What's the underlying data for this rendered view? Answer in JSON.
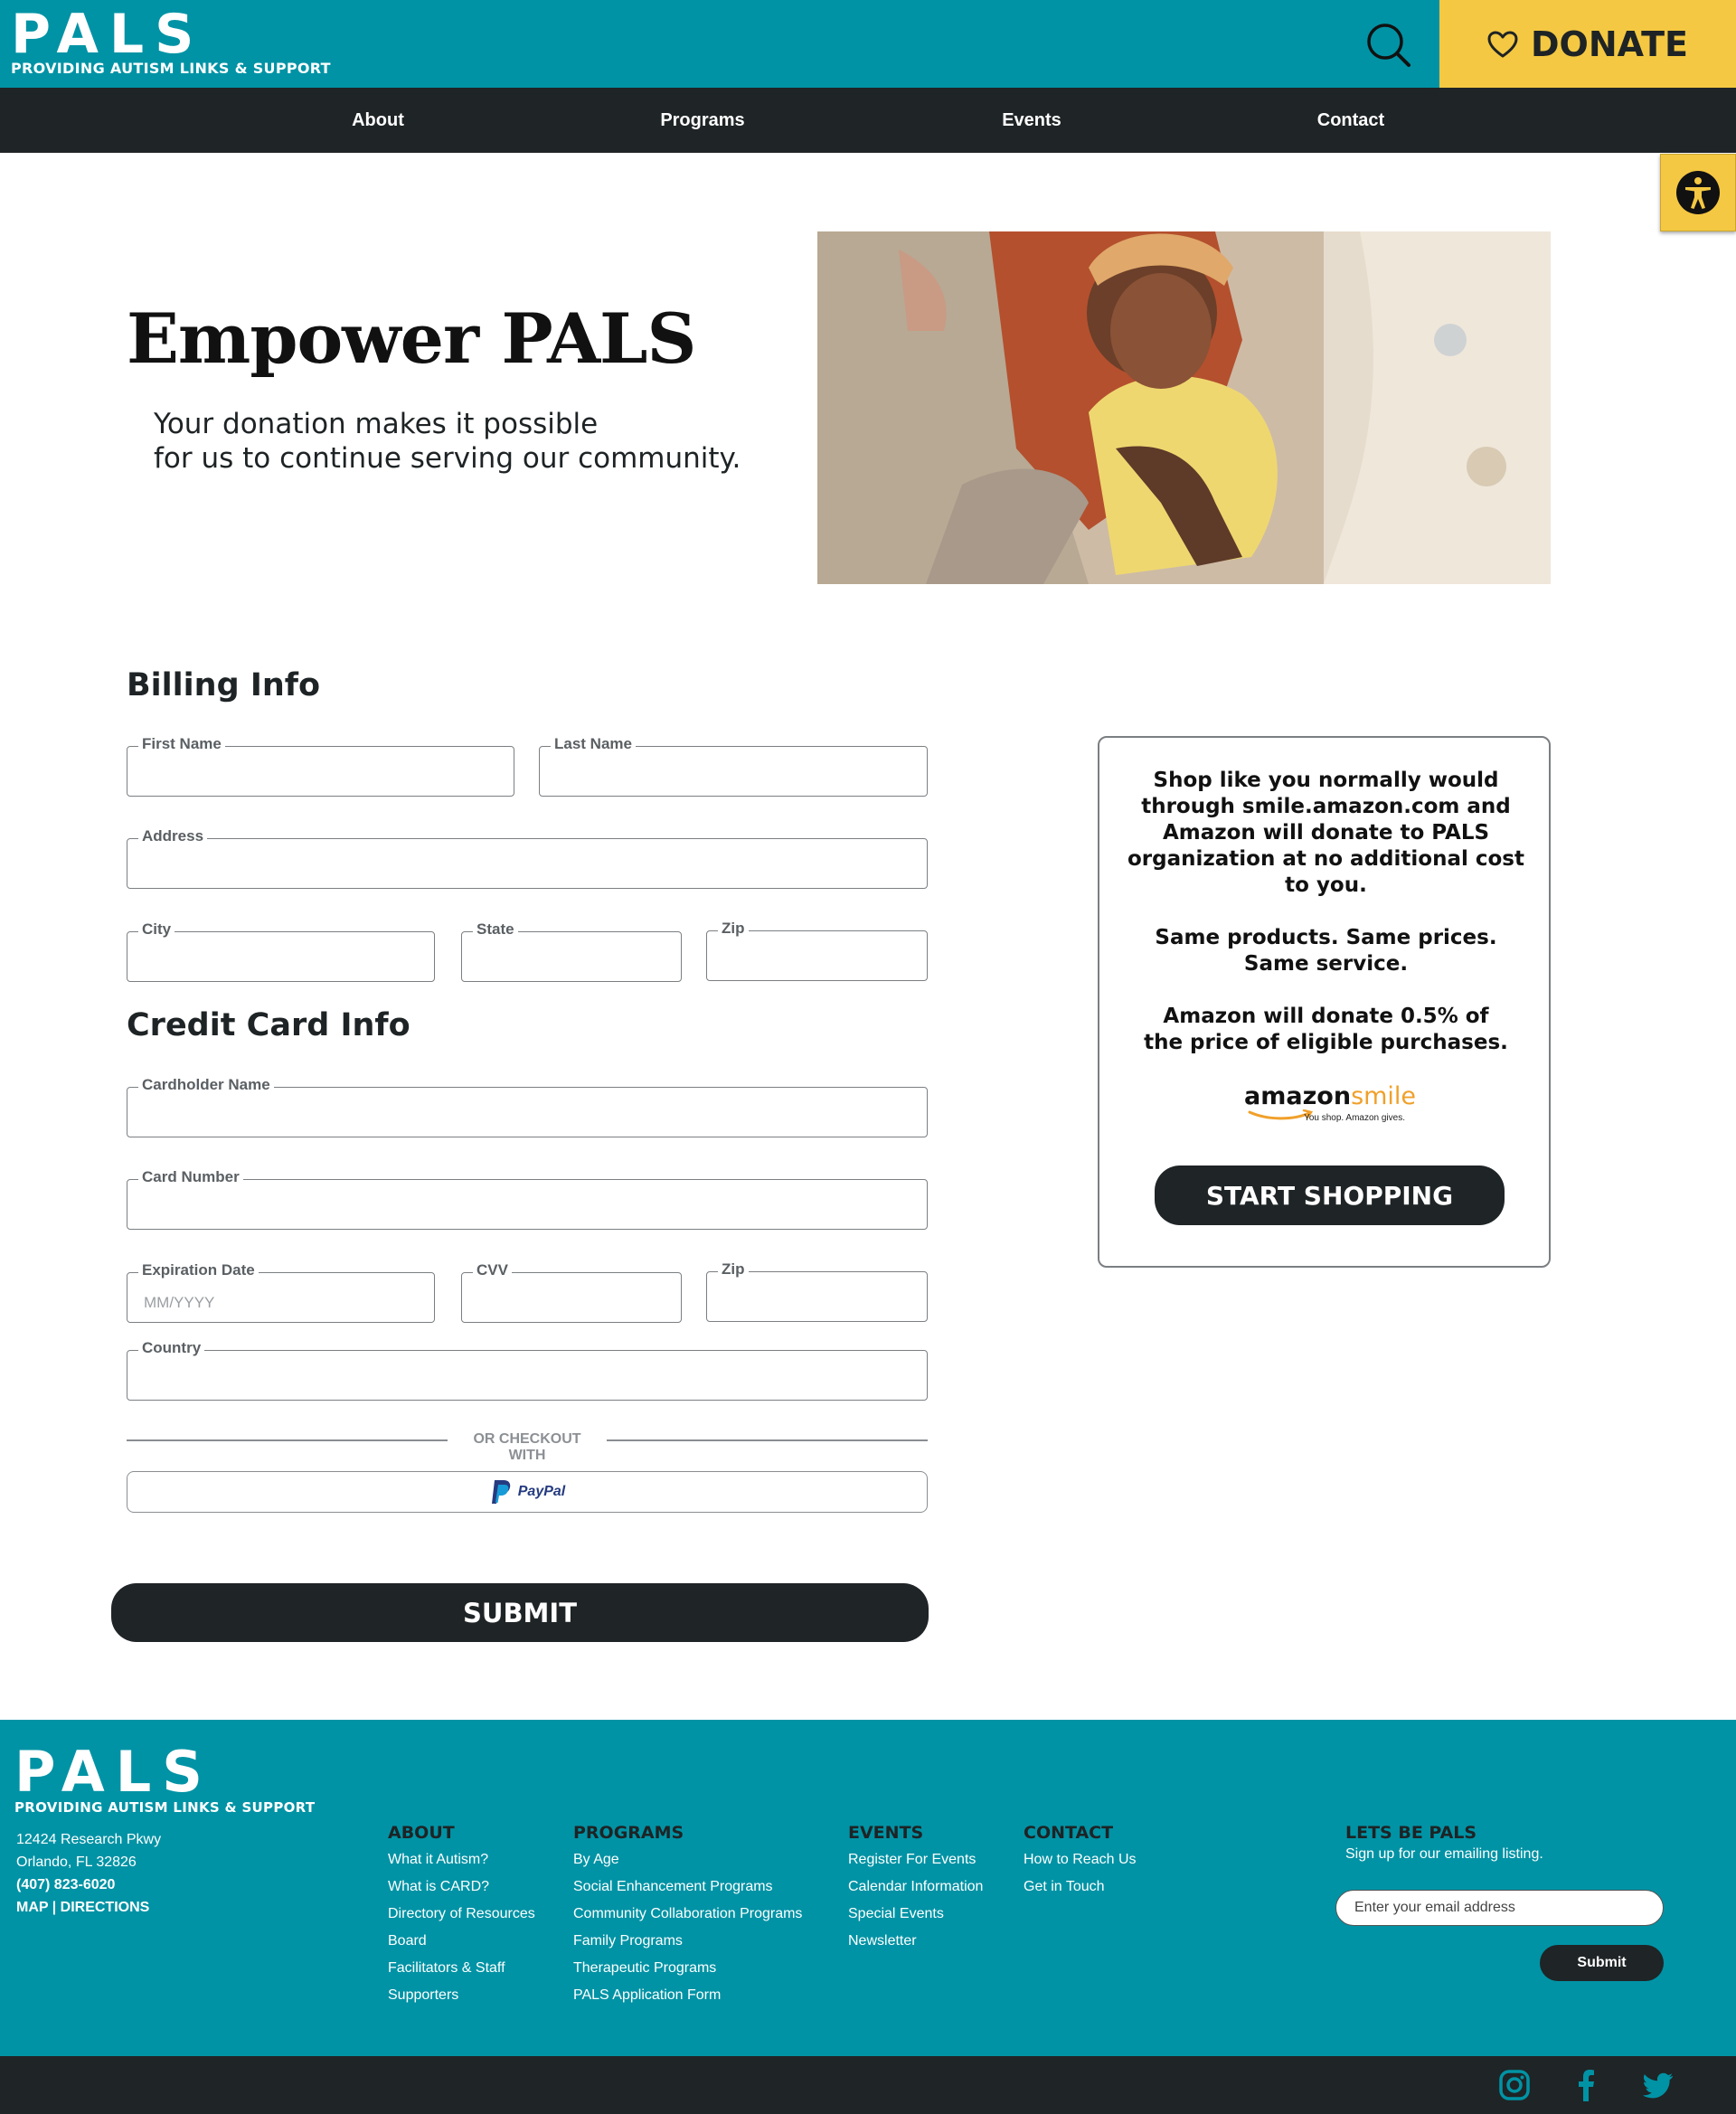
{
  "header": {
    "logo_word": "PALS",
    "logo_tagline": "PROVIDING AUTISM LINKS & SUPPORT",
    "donate_label": "DONATE",
    "icons": {
      "search": "search-icon",
      "donate": "heart-icon",
      "accessibility": "accessibility-icon"
    }
  },
  "nav": {
    "items": [
      "About",
      "Programs",
      "Events",
      "Contact"
    ]
  },
  "hero": {
    "title": "Empower PALS",
    "subtitle_line1": "Your donation makes it possible",
    "subtitle_line2": "for us to continue serving our community."
  },
  "billing": {
    "heading": "Billing Info",
    "first_name_label": "First Name",
    "last_name_label": "Last Name",
    "address_label": "Address",
    "city_label": "City",
    "state_label": "State",
    "zip_label": "Zip"
  },
  "credit": {
    "heading": "Credit Card Info",
    "cardholder_label": "Cardholder Name",
    "card_number_label": "Card Number",
    "expiration_label": "Expiration Date",
    "expiration_placeholder": "MM/YYYY",
    "cvv_label": "CVV",
    "zip_label": "Zip",
    "country_label": "Country"
  },
  "checkout": {
    "divider_text": "OR CHECKOUT WITH",
    "paypal_label": "PayPal",
    "submit_label": "SUBMIT"
  },
  "amazon": {
    "para1": "Shop like you normally would through smile.amazon.com and Amazon will donate to PALS organization at no additional cost to you.",
    "para2": "Same products. Same prices. Same service.",
    "para3": "Amazon will donate 0.5% of the price of eligible purchases.",
    "logo_word1": "amazon",
    "logo_word2": "smile",
    "logo_tag": "You shop. Amazon gives.",
    "button_label": "START SHOPPING"
  },
  "footer": {
    "logo_word": "PALS",
    "logo_tagline": "PROVIDING AUTISM LINKS & SUPPORT",
    "address1": "12424 Research Pkwy",
    "address2": "Orlando, FL 32826",
    "phone": "(407) 823-6020",
    "map_link": "MAP",
    "separator": " | ",
    "directions_link": "DIRECTIONS",
    "columns": [
      {
        "heading": "ABOUT",
        "links": [
          "What it Autism?",
          "What is CARD?",
          "Directory of Resources",
          "Board",
          "Facilitators & Staff",
          "Supporters"
        ]
      },
      {
        "heading": "PROGRAMS",
        "links": [
          "By Age",
          "Social Enhancement Programs",
          "Community Collaboration Programs",
          "Family Programs",
          "Therapeutic Programs",
          "PALS Application Form"
        ]
      },
      {
        "heading": "EVENTS",
        "links": [
          "Register For Events",
          "Calendar Information",
          "Special Events",
          "Newsletter"
        ]
      },
      {
        "heading": "CONTACT",
        "links": [
          "How to Reach Us",
          "Get in Touch"
        ]
      }
    ],
    "newsletter_heading": "LETS BE PALS",
    "newsletter_sub": "Sign up for our emailing listing.",
    "email_placeholder": "Enter your email address",
    "submit_label": "Submit"
  },
  "social": {
    "icons": [
      "instagram-icon",
      "facebook-icon",
      "twitter-icon"
    ]
  },
  "colors": {
    "teal": "#0093a5",
    "dark": "#1f2426",
    "yellow": "#f4c842"
  }
}
